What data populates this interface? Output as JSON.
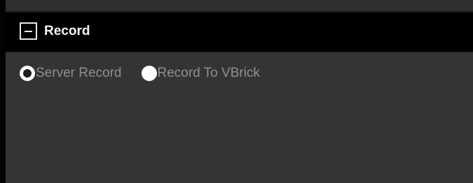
{
  "panel": {
    "title": "Record",
    "collapse_symbol": "minus-icon"
  },
  "record_options": [
    {
      "label": "Server Record",
      "selected": true
    },
    {
      "label": "Record To VBrick",
      "selected": false
    }
  ],
  "colors": {
    "header_background": "#000000",
    "panel_background": "#343434",
    "label_text": "#8f8f8f",
    "title_text": "#f4f4f4"
  }
}
